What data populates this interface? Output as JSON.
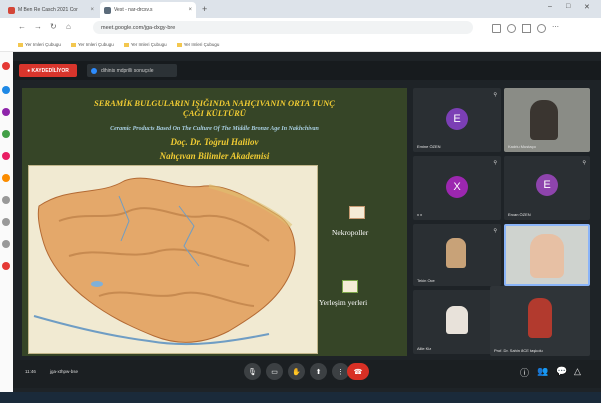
{
  "browser": {
    "tabs": [
      {
        "label": "M Ben Re Casch 2021 Cor",
        "close": "×",
        "color": "#d44638"
      },
      {
        "label": "Vest - nar-drcsv.s",
        "close": "×",
        "color": "#5b6b7a"
      }
    ],
    "new_tab": "+",
    "window_controls": [
      "–",
      "□",
      "✕"
    ],
    "nav": [
      "←",
      "→",
      "↻",
      "⌂"
    ],
    "url": "meet.google.com/jga-dxgy-bre",
    "bookmarks": [
      "Yer Imleri Çubugu",
      "Yer Imleri Çubugu",
      "Yer Imleri Çubugu",
      "Yer Imleri Çubugu"
    ]
  },
  "meeting": {
    "record_label": "● KAYDEDİLİYOR",
    "info_label": "dihinis mdprilli sonuçsle",
    "slide": {
      "title_line1": "SERAMİK BULGULARIN IŞIĞINDA  NAHÇIVANIN  ORTA TUNÇ",
      "title_line2": "ÇAĞI KÜLTÜRÜ",
      "subtitle": "Ceramic Products Based On The Culture Of The Middle Bronze Age In Nakhchivan",
      "author": "Doç. Dr. Toğrul Halilov",
      "institution": "Nahçıvan Bilimler Akademisi",
      "legend": [
        {
          "label": "Nekropoller",
          "color": "#b9643b"
        },
        {
          "label": "Yerleşim yerleri",
          "color": "#7da64a"
        }
      ]
    },
    "participants": [
      {
        "name": "Emine ÖZEN",
        "initial": "E",
        "color": "#7b3fb5",
        "type": "avatar"
      },
      {
        "name": "Kadriu Mustaço",
        "initial": "",
        "color": "",
        "type": "video"
      },
      {
        "name": "x x",
        "initial": "X",
        "color": "#9c27b0",
        "type": "avatar"
      },
      {
        "name": "Ercan ÖZEN",
        "initial": "E",
        "color": "#8e44ad",
        "type": "avatar"
      },
      {
        "name": "Tekin Oce",
        "initial": "",
        "color": "",
        "type": "photo"
      },
      {
        "name": "",
        "initial": "",
        "color": "",
        "type": "video"
      },
      {
        "name": "Alile Kiz",
        "initial": "",
        "color": "",
        "type": "photo"
      },
      {
        "name": "Prof. Dr. Sahin 8CE taşkolu",
        "initial": "",
        "color": "",
        "type": "video"
      }
    ],
    "time_code": "11:46",
    "meeting_code": "jga-xthpw-bse",
    "controls": [
      {
        "name": "mic",
        "glyph": "🎙",
        "color": "#3c4043"
      },
      {
        "name": "camera",
        "glyph": "▭",
        "color": "#3c4043"
      },
      {
        "name": "hand",
        "glyph": "✋",
        "color": "#3c4043"
      },
      {
        "name": "present",
        "glyph": "⬆",
        "color": "#3c4043"
      },
      {
        "name": "more",
        "glyph": "⋮",
        "color": "#3c4043"
      },
      {
        "name": "end",
        "glyph": "☎",
        "color": "#d93025"
      }
    ],
    "right_controls": [
      "ⓘ",
      "👥",
      "💬",
      "△"
    ]
  },
  "colors": {
    "accent": "#d8352c",
    "slide_bg": "#364527",
    "title_yellow": "#f1cc33"
  }
}
